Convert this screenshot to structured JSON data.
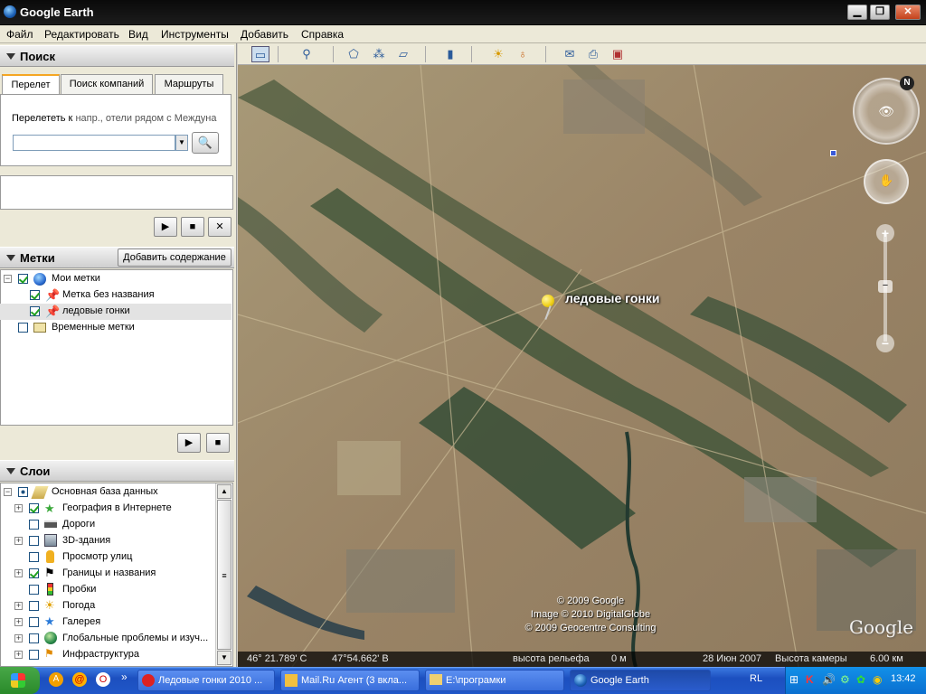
{
  "window": {
    "title": "Google Earth"
  },
  "menu": [
    "Файл",
    "Редактировать",
    "Вид",
    "Инструменты",
    "Добавить",
    "Справка"
  ],
  "search": {
    "header": "Поиск",
    "tabs": [
      "Перелет",
      "Поиск компаний",
      "Маршруты"
    ],
    "flyto_label": "Перелететь к",
    "flyto_hint": "напр., отели рядом с Междуна",
    "input_value": ""
  },
  "places": {
    "header": "Метки",
    "add_content_label": "Добавить содержание",
    "items": [
      "Мои метки",
      "Метка без названия",
      "ледовые гонки",
      "Временные метки"
    ]
  },
  "layers": {
    "header": "Слои",
    "items": [
      "Основная база данных",
      "География в Интернете",
      "Дороги",
      "3D-здания",
      "Просмотр улиц",
      "Границы и названия",
      "Пробки",
      "Погода",
      "Галерея",
      "Глобальные проблемы и изуч...",
      "Инфраструктура"
    ]
  },
  "map": {
    "placemark_label": "ледовые гонки",
    "copyright": [
      "© 2009 Google",
      "Image © 2010 DigitalGlobe",
      "© 2009 Geocentre Consulting"
    ],
    "logo": "Google",
    "compass_n": "N"
  },
  "status": {
    "lat": "46° 21.789' С",
    "lon": "47°54.662' В",
    "elev_label": "высота рельефа",
    "elev_value": "0 м",
    "date": "28 Июн 2007",
    "eye_label": "Высота камеры",
    "eye_value": "6.00 км"
  },
  "taskbar": {
    "tasks": [
      "Ледовые гонки 2010 ...",
      "Mail.Ru Агент (3 вкла...",
      "E:\\програмки",
      "Google Earth"
    ],
    "lang": "RL",
    "clock": "13:42"
  },
  "colors": {
    "accent": "#f5a623",
    "pin": "#f2d21c",
    "taskbar": "#2057c8"
  }
}
